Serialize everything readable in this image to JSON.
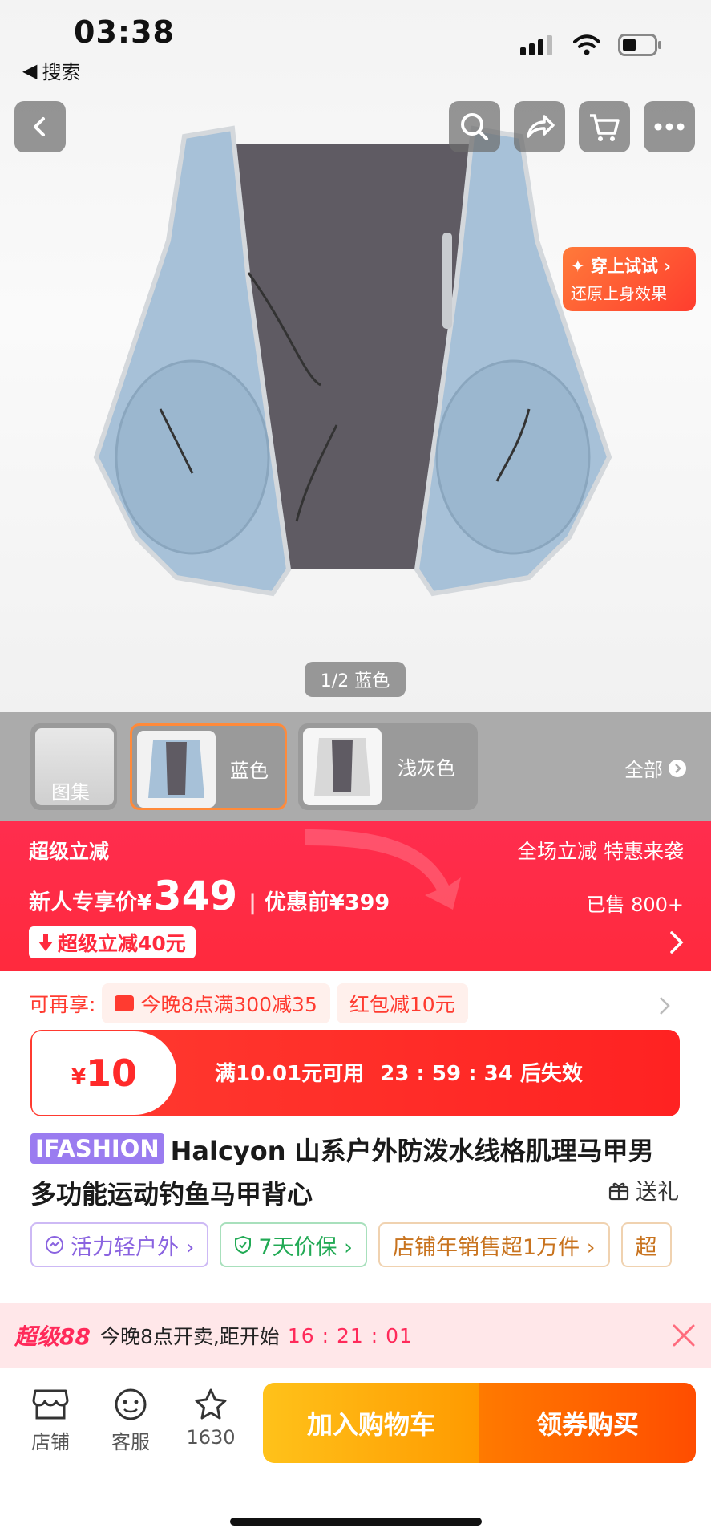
{
  "status_bar": {
    "time": "03:38",
    "back_label": "搜索",
    "icons": [
      "cellular-icon",
      "wifi-icon",
      "battery-icon"
    ]
  },
  "hero": {
    "pager": "1/2 蓝色",
    "tryon_line1": "✦ 穿上试试 ›",
    "tryon_line2": "还原上身效果",
    "nav_icons": [
      "back-icon",
      "search-icon",
      "share-icon",
      "cart-icon",
      "more-icon"
    ]
  },
  "thumbs": {
    "items": [
      {
        "label": "图集"
      },
      {
        "label": "蓝色"
      },
      {
        "label": "浅灰色"
      }
    ],
    "all_label": "全部"
  },
  "promo": {
    "title": "超级立减",
    "right_top": "全场立减 特惠来袭",
    "price_label": "新人专享价¥",
    "price": "349",
    "original": "优惠前¥399",
    "sold": "已售 800+",
    "badge": "超级立减40元"
  },
  "coupons": {
    "prefix": "可再享:",
    "chip1": "今晚8点满300减35",
    "chip2": "红包减10元",
    "card_currency": "¥",
    "card_amount": "10",
    "card_condition": "满10.01元可用",
    "card_timer": "23 : 59 : 34 后失效"
  },
  "product": {
    "brand": "IFASHION",
    "title": "Halcyon 山系户外防泼水线格肌理马甲男多功能运动钓鱼马甲背心",
    "gift": "送礼"
  },
  "tags": [
    {
      "label": "活力轻户外 ›",
      "color": "#8a63e0"
    },
    {
      "label": "7天价保 ›",
      "color": "#22aa55"
    },
    {
      "label": "店铺年销售超1万件 ›",
      "color": "#c8731e"
    },
    {
      "label": "超",
      "color": "#c8731e"
    }
  ],
  "super88": {
    "logo": "超级88",
    "text": "今晚8点开卖,距开始",
    "countdown": "16 : 21 : 01"
  },
  "bottom_bar": {
    "shop": "店铺",
    "service": "客服",
    "favorites": "1630",
    "add_to_cart": "加入购物车",
    "buy": "领券购买"
  },
  "colors": {
    "promo_red": "#ff2a3d",
    "cart_yellow": "#ffb000",
    "buy_orange": "#ff5a00",
    "brand_purple": "#9a7cf0"
  }
}
